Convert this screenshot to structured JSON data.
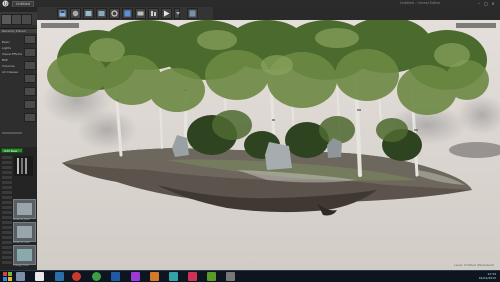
{
  "window": {
    "tab_label": "Untitled",
    "title": "Untitled - Unreal Editor"
  },
  "menu": [
    "File",
    "Edit",
    "Window",
    "Help"
  ],
  "left_panel": {
    "sections": [
      "Recently Placed",
      "Basic",
      "Lights",
      "Visual Effects",
      "BSP",
      "Volumes",
      "All Classes"
    ],
    "content_browser_button": "Add New",
    "thumbnails": [
      "Material_Bark",
      "Material_Leaf",
      "Foliage_Tree"
    ]
  },
  "viewport": {
    "mode_label": "Perspective",
    "lit_label": "Lit",
    "show_label": "Show",
    "level_stat": "Level: Untitled (Persistent)"
  },
  "taskbar": {
    "time": "12:34",
    "date": "01/01/2015"
  }
}
